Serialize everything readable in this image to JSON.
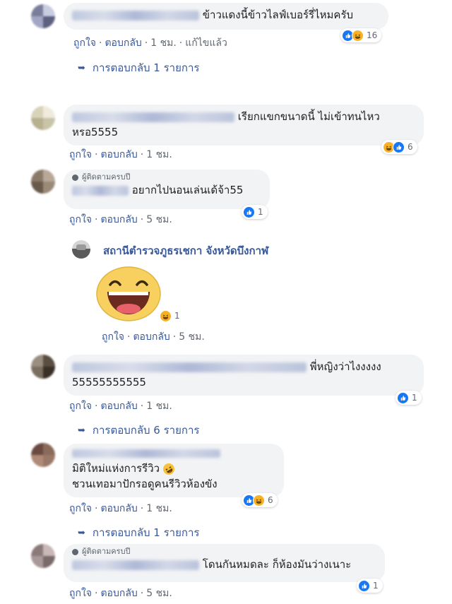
{
  "comments": [
    {
      "text": "ข้าวแดงนี้ข้าวไลฟ์เบอร์รี่ไหมครับ",
      "reaction_count": "16",
      "actions": {
        "like": "ถูกใจ",
        "reply": "ตอบกลับ",
        "time": "1 ชม.",
        "edited": "แก้ไขแล้ว"
      },
      "replies": "การตอบกลับ 1 รายการ"
    },
    {
      "text_line1": "เรียกแขกขนาดนี้ ไม่เข้าทนไหว",
      "text_line2": "หรอ5555",
      "reaction_count": "6",
      "actions": {
        "like": "ถูกใจ",
        "reply": "ตอบกลับ",
        "time": "1 ชม."
      }
    },
    {
      "badge": "ผู้ติดตามครบปี",
      "text": "อยากไปนอนเล่นเด้จ้า55",
      "reaction_count": "1",
      "actions": {
        "like": "ถูกใจ",
        "reply": "ตอบกลับ",
        "time": "5 ชม."
      }
    },
    {
      "text_line1": "พี่หญิงว่าไงงงงง",
      "text_line2": "55555555555",
      "reaction_count": "1",
      "actions": {
        "like": "ถูกใจ",
        "reply": "ตอบกลับ",
        "time": "1 ชม."
      },
      "replies": "การตอบกลับ 6 รายการ"
    },
    {
      "text_line1": "มิติใหม่แห่งการรีวิว",
      "text_line2": "ชวนเทอมาปักรอดูคนรีวิวห้องขัง",
      "reaction_count": "6",
      "actions": {
        "like": "ถูกใจ",
        "reply": "ตอบกลับ",
        "time": "1 ชม."
      },
      "replies": "การตอบกลับ 1 รายการ"
    },
    {
      "badge": "ผู้ติดตามครบปี",
      "text": "โดนกันหมดละ ก็ห้องมันว่างเนาะ",
      "reaction_count": "1",
      "actions": {
        "like": "ถูกใจ",
        "reply": "ตอบกลับ",
        "time": "5 ชม."
      }
    }
  ],
  "page_reply": {
    "page_name": "สถานีตำรวจภูธรเชกา จังหวัดบึงกาฬ",
    "reaction_count": "1",
    "actions": {
      "like": "ถูกใจ",
      "reply": "ตอบกลับ",
      "time": "5 ชม."
    }
  },
  "sep": "·",
  "colors": {
    "link": "#385898",
    "bubble": "#f2f3f5",
    "like": "#1877f2",
    "haha": "#f7b125"
  }
}
